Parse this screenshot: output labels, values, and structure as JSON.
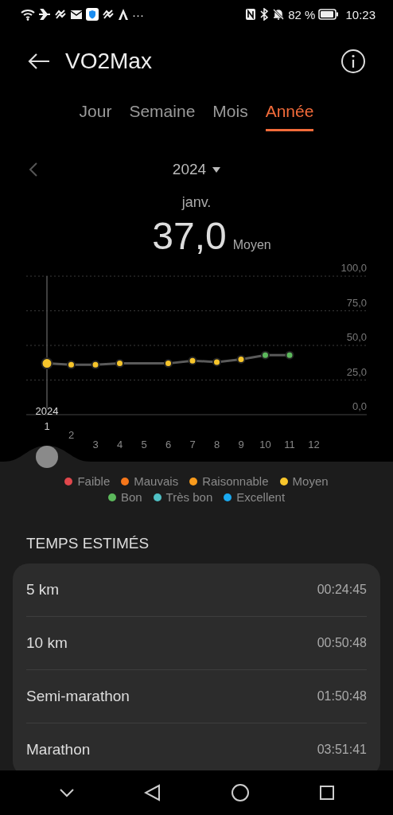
{
  "status_bar": {
    "more": "···",
    "battery": "82 %",
    "time": "10:23"
  },
  "header": {
    "title": "VO2Max"
  },
  "tabs": [
    {
      "label": "Jour",
      "selected": false
    },
    {
      "label": "Semaine",
      "selected": false
    },
    {
      "label": "Mois",
      "selected": false
    },
    {
      "label": "Année",
      "selected": true
    }
  ],
  "year_selector": {
    "label": "2024"
  },
  "summary": {
    "period": "janv.",
    "value": "37,0",
    "rating": "Moyen"
  },
  "chart": {
    "chart_data": {
      "type": "line",
      "categories": [
        "1",
        "2",
        "3",
        "4",
        "5",
        "6",
        "7",
        "8",
        "9",
        "10",
        "11",
        "12"
      ],
      "series": [
        {
          "name": "Moyen",
          "color": "#f7c52b",
          "marker": "o",
          "values": [
            37,
            36,
            36,
            37,
            null,
            37,
            39,
            38,
            40,
            null,
            null,
            null
          ]
        },
        {
          "name": "Bon",
          "color": "#5cb85c",
          "marker": "o",
          "values": [
            null,
            null,
            null,
            null,
            null,
            null,
            null,
            null,
            null,
            43,
            43,
            null
          ]
        }
      ],
      "ylim": [
        0,
        100
      ],
      "grid": true,
      "annotations": [
        {
          "x": "1",
          "text": "2024"
        }
      ],
      "yticks": [
        {
          "value": 0,
          "label": "0,0"
        },
        {
          "value": 25,
          "label": "25,0"
        },
        {
          "value": 50,
          "label": "50,0"
        },
        {
          "value": 75,
          "label": "75,0"
        },
        {
          "value": 100,
          "label": "100,0"
        }
      ]
    }
  },
  "legend": [
    {
      "kind": "rating",
      "label": "Faible",
      "color": "#e0474c"
    },
    {
      "kind": "rating",
      "label": "Mauvais",
      "color": "#f5761a"
    },
    {
      "kind": "rating",
      "label": "Raisonnable",
      "color": "#f89a1c"
    },
    {
      "kind": "series"
    },
    {
      "kind": "series"
    },
    {
      "kind": "rating",
      "label": "Très bon",
      "color": "#4fc0c4"
    },
    {
      "kind": "rating",
      "label": "Excellent",
      "color": "#1aa9f0"
    }
  ],
  "estimated_times": {
    "title": "TEMPS ESTIMÉS",
    "rows": [
      {
        "label": "5 km",
        "time": "00:24:45"
      },
      {
        "label": "10 km",
        "time": "00:50:48"
      },
      {
        "label": "Semi-marathon",
        "time": "01:50:48"
      },
      {
        "label": "Marathon",
        "time": "03:51:41"
      }
    ]
  }
}
